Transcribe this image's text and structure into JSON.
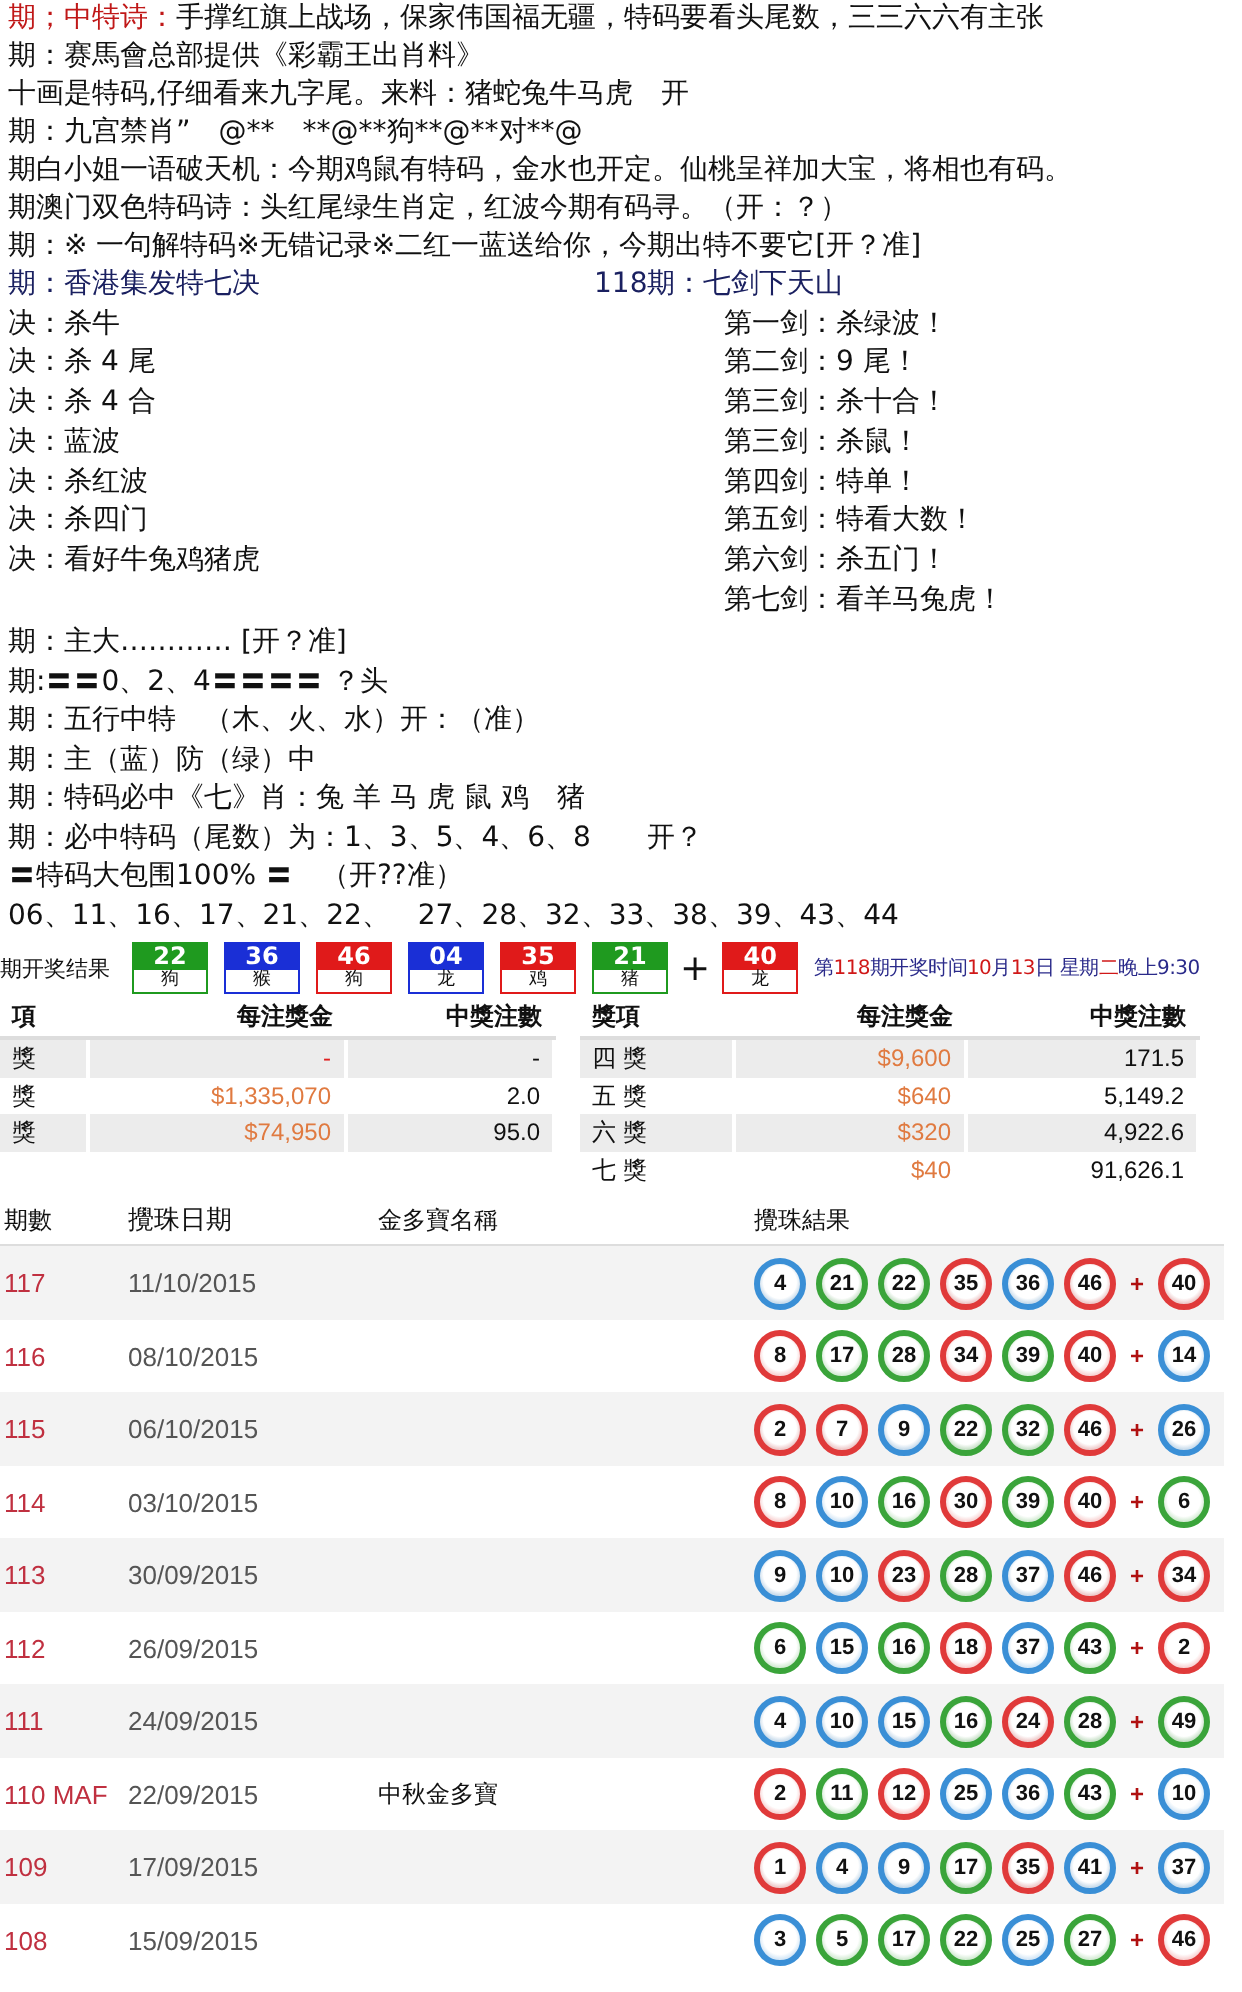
{
  "poem_lines": [
    {
      "label": "期；中特诗：",
      "text": "手撑红旗上战场，保家伟国福无疆，特码要看头尾数，三三六六有主张"
    },
    {
      "text": "期：赛馬會总部提供《彩霸王出肖料》"
    },
    {
      "text": "十画是特码,仔细看来九字尾。来料：猪蛇兔牛马虎　开"
    },
    {
      "text": "期：九宫禁肖”　@**　**@**狗**@**对**@"
    },
    {
      "text": "期白小姐一语破天机：今期鸡鼠有特码，金水也开定。仙桃呈祥加大宝，将相也有码。"
    },
    {
      "text": "期澳门双色特码诗：头红尾绿生肖定，红波今期有码寻。（开：？）"
    },
    {
      "text": "期：※ 一句解特码※无错记录※二红一蓝送给你，今期出特不要它[开？准]"
    }
  ],
  "secrets": {
    "left_title": "期：香港集发特七决",
    "right_title": "118期：七剑下天山",
    "left_items": [
      "决：杀牛",
      "决：杀 4 尾",
      "决：杀 4 合",
      "决：蓝波",
      "决：杀红波",
      "决：杀四门",
      "决：看好牛兔鸡猪虎"
    ],
    "right_items": [
      "第一剑：杀绿波！",
      "第二剑：9 尾！",
      "第三剑：杀十合！",
      "第三剑：杀鼠！",
      "第四剑：特单！",
      "第五剑：特看大数！",
      "第六剑：杀五门！",
      "第七剑：看羊马兔虎！"
    ]
  },
  "tip_lines": [
    "期：主大………… [开？准]",
    "期:〓〓0、2、4〓〓〓〓 ？头",
    "期：五行中特　（木、火、水）开：（准）",
    "期：主（蓝）防（绿）中",
    "期：特码必中《七》肖：兔 羊 马 虎 鼠 鸡　猪",
    "期：必中特码（尾数）为：1、3、5、4、6、8　　开？",
    "〓特码大包围100% 〓　（开??准）",
    "06、11、16、17、21、22、　27、28、32、33、38、39、43、44"
  ],
  "result_bar": {
    "label": "期开奖结果",
    "balls": [
      {
        "number": "22",
        "animal": "狗",
        "color": "#1f9a1f"
      },
      {
        "number": "36",
        "animal": "猴",
        "color": "#1a2fd6"
      },
      {
        "number": "46",
        "animal": "狗",
        "color": "#e01a1a"
      },
      {
        "number": "04",
        "animal": "龙",
        "color": "#1a2fd6"
      },
      {
        "number": "35",
        "animal": "鸡",
        "color": "#e01a1a"
      },
      {
        "number": "21",
        "animal": "猪",
        "color": "#1f9a1f"
      }
    ],
    "plus": "+",
    "special": {
      "number": "40",
      "animal": "龙",
      "color": "#e01a1a"
    },
    "info": [
      {
        "text": "第",
        "color": "#2a2a8a"
      },
      {
        "text": "118",
        "color": "#d01818"
      },
      {
        "text": "期开奖时间",
        "color": "#2a2a8a"
      },
      {
        "text": "10",
        "color": "#d01818"
      },
      {
        "text": "月",
        "color": "#2a2a8a"
      },
      {
        "text": "13",
        "color": "#d01818"
      },
      {
        "text": "日 星期",
        "color": "#2a2a8a"
      },
      {
        "text": "二",
        "color": "#d01818"
      },
      {
        "text": "晚上9:30",
        "color": "#2a2a8a"
      }
    ]
  },
  "prize_tables": [
    {
      "columns": [
        "項",
        "每注獎金",
        "中獎注數"
      ],
      "rows": [
        [
          "獎",
          "-",
          "-"
        ],
        [
          "獎",
          "$1,335,070",
          "2.0"
        ],
        [
          "獎",
          "$74,950",
          "95.0"
        ]
      ]
    },
    {
      "columns": [
        "獎項",
        "每注獎金",
        "中獎注數"
      ],
      "rows": [
        [
          "四 獎",
          "$9,600",
          "171.5"
        ],
        [
          "五 獎",
          "$640",
          "5,149.2"
        ],
        [
          "六 獎",
          "$320",
          "4,922.6"
        ],
        [
          "七 獎",
          "$40",
          "91,626.1"
        ]
      ]
    }
  ],
  "draws_table": {
    "columns": [
      "期數",
      "攪珠日期",
      "金多寶名稱",
      "攪珠結果"
    ],
    "plus": "+",
    "rows": [
      {
        "draw": "117",
        "date": "11/10/2015",
        "name": "",
        "balls": [
          {
            "n": "4",
            "color": "#3a8fd6"
          },
          {
            "n": "21",
            "color": "#3aa43a"
          },
          {
            "n": "22",
            "color": "#3aa43a"
          },
          {
            "n": "35",
            "color": "#e03a3a"
          },
          {
            "n": "36",
            "color": "#3a8fd6"
          },
          {
            "n": "46",
            "color": "#e03a3a"
          },
          {
            "n": "40",
            "color": "#e03a3a"
          }
        ]
      },
      {
        "draw": "116",
        "date": "08/10/2015",
        "name": "",
        "balls": [
          {
            "n": "8",
            "color": "#e03a3a"
          },
          {
            "n": "17",
            "color": "#3aa43a"
          },
          {
            "n": "28",
            "color": "#3aa43a"
          },
          {
            "n": "34",
            "color": "#e03a3a"
          },
          {
            "n": "39",
            "color": "#3aa43a"
          },
          {
            "n": "40",
            "color": "#e03a3a"
          },
          {
            "n": "14",
            "color": "#3a8fd6"
          }
        ]
      },
      {
        "draw": "115",
        "date": "06/10/2015",
        "name": "",
        "balls": [
          {
            "n": "2",
            "color": "#e03a3a"
          },
          {
            "n": "7",
            "color": "#e03a3a"
          },
          {
            "n": "9",
            "color": "#3a8fd6"
          },
          {
            "n": "22",
            "color": "#3aa43a"
          },
          {
            "n": "32",
            "color": "#3aa43a"
          },
          {
            "n": "46",
            "color": "#e03a3a"
          },
          {
            "n": "26",
            "color": "#3a8fd6"
          }
        ]
      },
      {
        "draw": "114",
        "date": "03/10/2015",
        "name": "",
        "balls": [
          {
            "n": "8",
            "color": "#e03a3a"
          },
          {
            "n": "10",
            "color": "#3a8fd6"
          },
          {
            "n": "16",
            "color": "#3aa43a"
          },
          {
            "n": "30",
            "color": "#e03a3a"
          },
          {
            "n": "39",
            "color": "#3aa43a"
          },
          {
            "n": "40",
            "color": "#e03a3a"
          },
          {
            "n": "6",
            "color": "#3aa43a"
          }
        ]
      },
      {
        "draw": "113",
        "date": "30/09/2015",
        "name": "",
        "balls": [
          {
            "n": "9",
            "color": "#3a8fd6"
          },
          {
            "n": "10",
            "color": "#3a8fd6"
          },
          {
            "n": "23",
            "color": "#e03a3a"
          },
          {
            "n": "28",
            "color": "#3aa43a"
          },
          {
            "n": "37",
            "color": "#3a8fd6"
          },
          {
            "n": "46",
            "color": "#e03a3a"
          },
          {
            "n": "34",
            "color": "#e03a3a"
          }
        ]
      },
      {
        "draw": "112",
        "date": "26/09/2015",
        "name": "",
        "balls": [
          {
            "n": "6",
            "color": "#3aa43a"
          },
          {
            "n": "15",
            "color": "#3a8fd6"
          },
          {
            "n": "16",
            "color": "#3aa43a"
          },
          {
            "n": "18",
            "color": "#e03a3a"
          },
          {
            "n": "37",
            "color": "#3a8fd6"
          },
          {
            "n": "43",
            "color": "#3aa43a"
          },
          {
            "n": "2",
            "color": "#e03a3a"
          }
        ]
      },
      {
        "draw": "111",
        "date": "24/09/2015",
        "name": "",
        "balls": [
          {
            "n": "4",
            "color": "#3a8fd6"
          },
          {
            "n": "10",
            "color": "#3a8fd6"
          },
          {
            "n": "15",
            "color": "#3a8fd6"
          },
          {
            "n": "16",
            "color": "#3aa43a"
          },
          {
            "n": "24",
            "color": "#e03a3a"
          },
          {
            "n": "28",
            "color": "#3aa43a"
          },
          {
            "n": "49",
            "color": "#3aa43a"
          }
        ]
      },
      {
        "draw": "110 MAF",
        "date": "22/09/2015",
        "name": "中秋金多寶",
        "balls": [
          {
            "n": "2",
            "color": "#e03a3a"
          },
          {
            "n": "11",
            "color": "#3aa43a"
          },
          {
            "n": "12",
            "color": "#e03a3a"
          },
          {
            "n": "25",
            "color": "#3a8fd6"
          },
          {
            "n": "36",
            "color": "#3a8fd6"
          },
          {
            "n": "43",
            "color": "#3aa43a"
          },
          {
            "n": "10",
            "color": "#3a8fd6"
          }
        ]
      },
      {
        "draw": "109",
        "date": "17/09/2015",
        "name": "",
        "balls": [
          {
            "n": "1",
            "color": "#e03a3a"
          },
          {
            "n": "4",
            "color": "#3a8fd6"
          },
          {
            "n": "9",
            "color": "#3a8fd6"
          },
          {
            "n": "17",
            "color": "#3aa43a"
          },
          {
            "n": "35",
            "color": "#e03a3a"
          },
          {
            "n": "41",
            "color": "#3a8fd6"
          },
          {
            "n": "37",
            "color": "#3a8fd6"
          }
        ]
      },
      {
        "draw": "108",
        "date": "15/09/2015",
        "name": "",
        "balls": [
          {
            "n": "3",
            "color": "#3a8fd6"
          },
          {
            "n": "5",
            "color": "#3aa43a"
          },
          {
            "n": "17",
            "color": "#3aa43a"
          },
          {
            "n": "22",
            "color": "#3aa43a"
          },
          {
            "n": "25",
            "color": "#3a8fd6"
          },
          {
            "n": "27",
            "color": "#3aa43a"
          },
          {
            "n": "46",
            "color": "#e03a3a"
          }
        ]
      }
    ]
  }
}
